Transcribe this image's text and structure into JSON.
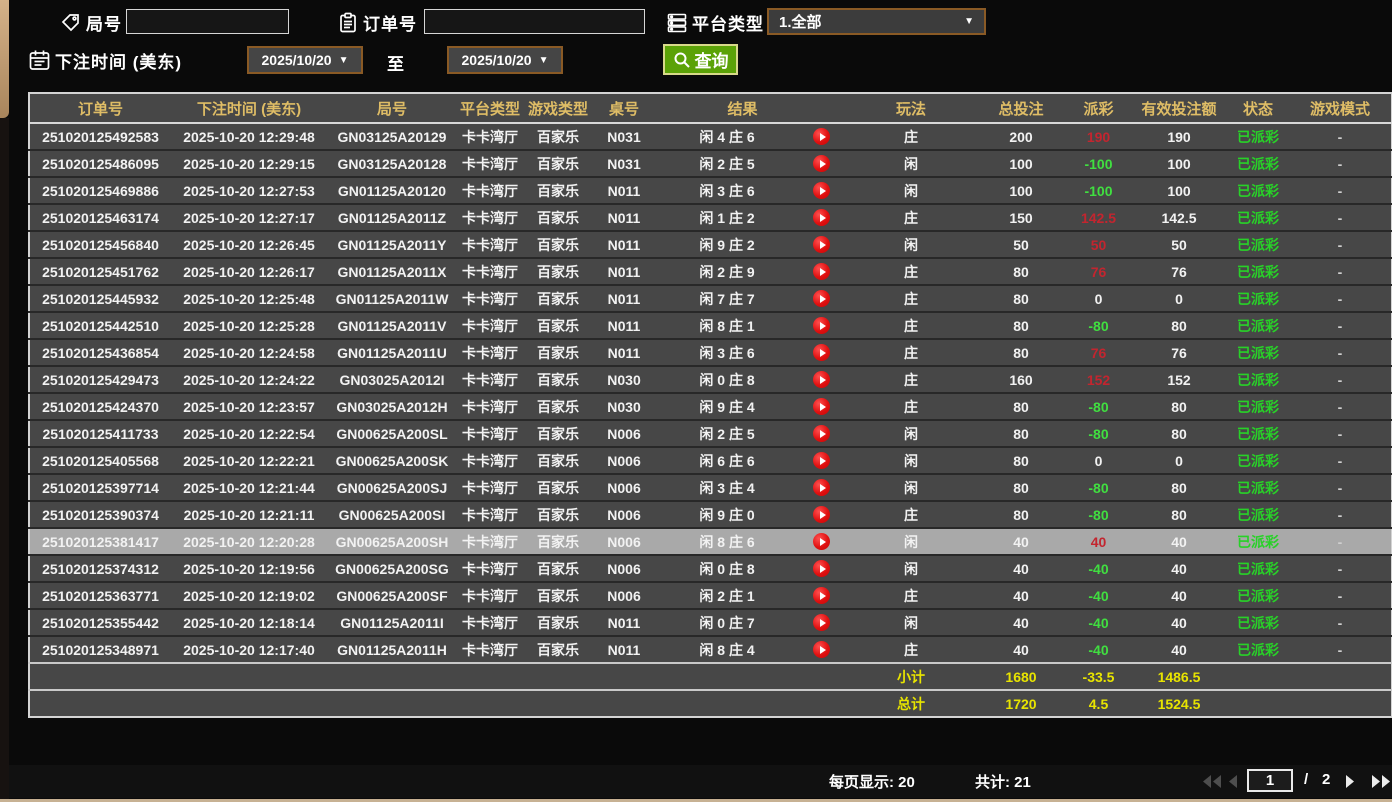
{
  "filters": {
    "round_label": "局号",
    "round_value": "",
    "order_label": "订单号",
    "order_value": "",
    "platform_label": "平台类型",
    "platform_value": "1.全部",
    "bet_time_label": "下注时间 (美东)",
    "to_label": "至",
    "date_from": "2025/10/20",
    "date_to": "2025/10/20",
    "query_label": "查询"
  },
  "table": {
    "headers": [
      "订单号",
      "下注时间 (美东)",
      "局号",
      "平台类型",
      "游戏类型",
      "桌号",
      "结果",
      "玩法",
      "总投注",
      "派彩",
      "有效投注额",
      "状态",
      "游戏模式"
    ],
    "rows": [
      {
        "order": "251020125492583",
        "time": "2025-10-20 12:29:48",
        "round": "GN03125A20129",
        "platform": "卡卡湾厅",
        "game_type": "百家乐",
        "table_no": "N031",
        "result": "闲 4 庄 6",
        "play": "庄",
        "total_bet": "200",
        "payout": "190",
        "valid_bet": "190",
        "status": "已派彩",
        "mode": "-",
        "highlighted": false
      },
      {
        "order": "251020125486095",
        "time": "2025-10-20 12:29:15",
        "round": "GN03125A20128",
        "platform": "卡卡湾厅",
        "game_type": "百家乐",
        "table_no": "N031",
        "result": "闲 2 庄 5",
        "play": "闲",
        "total_bet": "100",
        "payout": "-100",
        "valid_bet": "100",
        "status": "已派彩",
        "mode": "-",
        "highlighted": false
      },
      {
        "order": "251020125469886",
        "time": "2025-10-20 12:27:53",
        "round": "GN01125A20120",
        "platform": "卡卡湾厅",
        "game_type": "百家乐",
        "table_no": "N011",
        "result": "闲 3 庄 6",
        "play": "闲",
        "total_bet": "100",
        "payout": "-100",
        "valid_bet": "100",
        "status": "已派彩",
        "mode": "-",
        "highlighted": false
      },
      {
        "order": "251020125463174",
        "time": "2025-10-20 12:27:17",
        "round": "GN01125A2011Z",
        "platform": "卡卡湾厅",
        "game_type": "百家乐",
        "table_no": "N011",
        "result": "闲 1 庄 2",
        "play": "庄",
        "total_bet": "150",
        "payout": "142.5",
        "valid_bet": "142.5",
        "status": "已派彩",
        "mode": "-",
        "highlighted": false
      },
      {
        "order": "251020125456840",
        "time": "2025-10-20 12:26:45",
        "round": "GN01125A2011Y",
        "platform": "卡卡湾厅",
        "game_type": "百家乐",
        "table_no": "N011",
        "result": "闲 9 庄 2",
        "play": "闲",
        "total_bet": "50",
        "payout": "50",
        "valid_bet": "50",
        "status": "已派彩",
        "mode": "-",
        "highlighted": false
      },
      {
        "order": "251020125451762",
        "time": "2025-10-20 12:26:17",
        "round": "GN01125A2011X",
        "platform": "卡卡湾厅",
        "game_type": "百家乐",
        "table_no": "N011",
        "result": "闲 2 庄 9",
        "play": "庄",
        "total_bet": "80",
        "payout": "76",
        "valid_bet": "76",
        "status": "已派彩",
        "mode": "-",
        "highlighted": false
      },
      {
        "order": "251020125445932",
        "time": "2025-10-20 12:25:48",
        "round": "GN01125A2011W",
        "platform": "卡卡湾厅",
        "game_type": "百家乐",
        "table_no": "N011",
        "result": "闲 7 庄 7",
        "play": "庄",
        "total_bet": "80",
        "payout": "0",
        "valid_bet": "0",
        "status": "已派彩",
        "mode": "-",
        "highlighted": false
      },
      {
        "order": "251020125442510",
        "time": "2025-10-20 12:25:28",
        "round": "GN01125A2011V",
        "platform": "卡卡湾厅",
        "game_type": "百家乐",
        "table_no": "N011",
        "result": "闲 8 庄 1",
        "play": "庄",
        "total_bet": "80",
        "payout": "-80",
        "valid_bet": "80",
        "status": "已派彩",
        "mode": "-",
        "highlighted": false
      },
      {
        "order": "251020125436854",
        "time": "2025-10-20 12:24:58",
        "round": "GN01125A2011U",
        "platform": "卡卡湾厅",
        "game_type": "百家乐",
        "table_no": "N011",
        "result": "闲 3 庄 6",
        "play": "庄",
        "total_bet": "80",
        "payout": "76",
        "valid_bet": "76",
        "status": "已派彩",
        "mode": "-",
        "highlighted": false
      },
      {
        "order": "251020125429473",
        "time": "2025-10-20 12:24:22",
        "round": "GN03025A2012I",
        "platform": "卡卡湾厅",
        "game_type": "百家乐",
        "table_no": "N030",
        "result": "闲 0 庄 8",
        "play": "庄",
        "total_bet": "160",
        "payout": "152",
        "valid_bet": "152",
        "status": "已派彩",
        "mode": "-",
        "highlighted": false
      },
      {
        "order": "251020125424370",
        "time": "2025-10-20 12:23:57",
        "round": "GN03025A2012H",
        "platform": "卡卡湾厅",
        "game_type": "百家乐",
        "table_no": "N030",
        "result": "闲 9 庄 4",
        "play": "庄",
        "total_bet": "80",
        "payout": "-80",
        "valid_bet": "80",
        "status": "已派彩",
        "mode": "-",
        "highlighted": false
      },
      {
        "order": "251020125411733",
        "time": "2025-10-20 12:22:54",
        "round": "GN00625A200SL",
        "platform": "卡卡湾厅",
        "game_type": "百家乐",
        "table_no": "N006",
        "result": "闲 2 庄 5",
        "play": "闲",
        "total_bet": "80",
        "payout": "-80",
        "valid_bet": "80",
        "status": "已派彩",
        "mode": "-",
        "highlighted": false
      },
      {
        "order": "251020125405568",
        "time": "2025-10-20 12:22:21",
        "round": "GN00625A200SK",
        "platform": "卡卡湾厅",
        "game_type": "百家乐",
        "table_no": "N006",
        "result": "闲 6 庄 6",
        "play": "闲",
        "total_bet": "80",
        "payout": "0",
        "valid_bet": "0",
        "status": "已派彩",
        "mode": "-",
        "highlighted": false
      },
      {
        "order": "251020125397714",
        "time": "2025-10-20 12:21:44",
        "round": "GN00625A200SJ",
        "platform": "卡卡湾厅",
        "game_type": "百家乐",
        "table_no": "N006",
        "result": "闲 3 庄 4",
        "play": "闲",
        "total_bet": "80",
        "payout": "-80",
        "valid_bet": "80",
        "status": "已派彩",
        "mode": "-",
        "highlighted": false
      },
      {
        "order": "251020125390374",
        "time": "2025-10-20 12:21:11",
        "round": "GN00625A200SI",
        "platform": "卡卡湾厅",
        "game_type": "百家乐",
        "table_no": "N006",
        "result": "闲 9 庄 0",
        "play": "庄",
        "total_bet": "80",
        "payout": "-80",
        "valid_bet": "80",
        "status": "已派彩",
        "mode": "-",
        "highlighted": false
      },
      {
        "order": "251020125381417",
        "time": "2025-10-20 12:20:28",
        "round": "GN00625A200SH",
        "platform": "卡卡湾厅",
        "game_type": "百家乐",
        "table_no": "N006",
        "result": "闲 8 庄 6",
        "play": "闲",
        "total_bet": "40",
        "payout": "40",
        "valid_bet": "40",
        "status": "已派彩",
        "mode": "-",
        "highlighted": true
      },
      {
        "order": "251020125374312",
        "time": "2025-10-20 12:19:56",
        "round": "GN00625A200SG",
        "platform": "卡卡湾厅",
        "game_type": "百家乐",
        "table_no": "N006",
        "result": "闲 0 庄 8",
        "play": "闲",
        "total_bet": "40",
        "payout": "-40",
        "valid_bet": "40",
        "status": "已派彩",
        "mode": "-",
        "highlighted": false
      },
      {
        "order": "251020125363771",
        "time": "2025-10-20 12:19:02",
        "round": "GN00625A200SF",
        "platform": "卡卡湾厅",
        "game_type": "百家乐",
        "table_no": "N006",
        "result": "闲 2 庄 1",
        "play": "庄",
        "total_bet": "40",
        "payout": "-40",
        "valid_bet": "40",
        "status": "已派彩",
        "mode": "-",
        "highlighted": false
      },
      {
        "order": "251020125355442",
        "time": "2025-10-20 12:18:14",
        "round": "GN01125A2011I",
        "platform": "卡卡湾厅",
        "game_type": "百家乐",
        "table_no": "N011",
        "result": "闲 0 庄 7",
        "play": "闲",
        "total_bet": "40",
        "payout": "-40",
        "valid_bet": "40",
        "status": "已派彩",
        "mode": "-",
        "highlighted": false
      },
      {
        "order": "251020125348971",
        "time": "2025-10-20 12:17:40",
        "round": "GN01125A2011H",
        "platform": "卡卡湾厅",
        "game_type": "百家乐",
        "table_no": "N011",
        "result": "闲 8 庄 4",
        "play": "庄",
        "total_bet": "40",
        "payout": "-40",
        "valid_bet": "40",
        "status": "已派彩",
        "mode": "-",
        "highlighted": false
      }
    ],
    "subtotal": {
      "label": "小计",
      "total_bet": "1680",
      "payout": "-33.5",
      "valid_bet": "1486.5"
    },
    "grand_total": {
      "label": "总计",
      "total_bet": "1720",
      "payout": "4.5",
      "valid_bet": "1524.5"
    }
  },
  "pagination": {
    "per_page_label": "每页显示: 20",
    "total_label": "共计: 21",
    "page": "1",
    "separator": "/",
    "total_pages": "2"
  },
  "colors": {
    "header_gold": "#dfbd66",
    "win_red": "#c3252f",
    "loss_green": "#40df40",
    "status_green": "#28d128",
    "total_yellow": "#e8e400",
    "query_button_green": "#5ba207",
    "date_border_brown": "#8a5a25",
    "highlight_row_gray": "#a9a9a9"
  }
}
